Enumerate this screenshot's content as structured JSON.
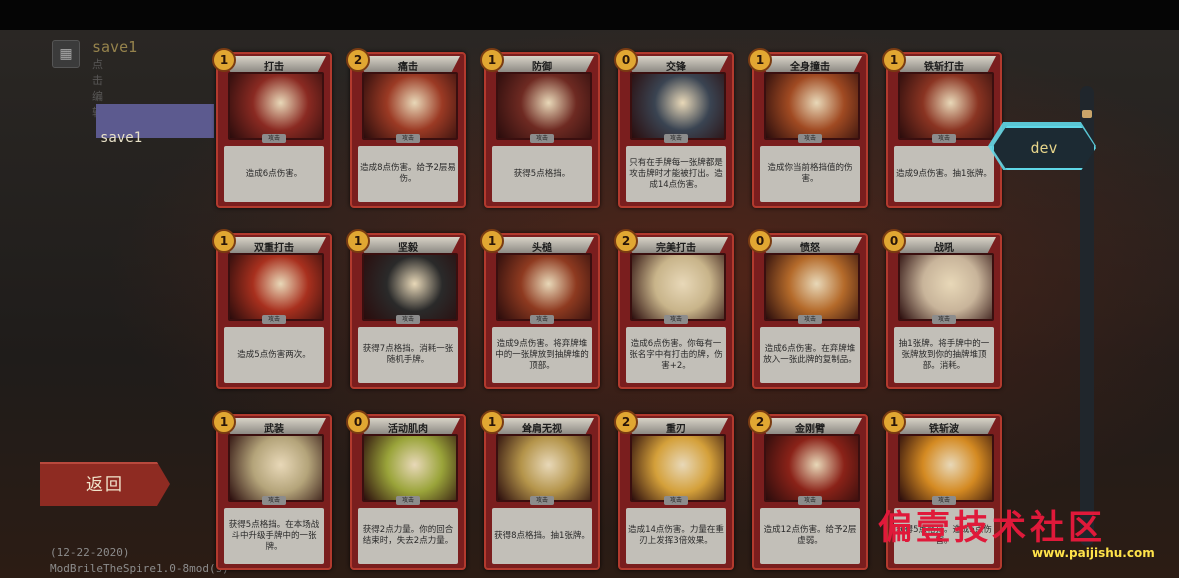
{
  "save": {
    "name": "save1",
    "subtitle": "点击编辑",
    "slot_label": "save1"
  },
  "back_label": "返回",
  "dev_label": "dev",
  "footer": {
    "date": "(12-22-2020)",
    "mod": "ModBrileTheSpire1.0-8mod(s)"
  },
  "watermark": {
    "text": "偏壹技术社区",
    "url": "www.paijishu.com"
  },
  "card_type_label": "攻击",
  "colors": {
    "card_frame": "#b23a2e",
    "card_body": "#7a1e1e",
    "cost_orb": "#e1a732",
    "dev_border": "#5fd8e8",
    "back_button": "#8e2b22"
  },
  "cards": [
    {
      "name": "打击",
      "cost": "1",
      "desc": "造成6点伤害。",
      "art": "#8a2a22"
    },
    {
      "name": "痛击",
      "cost": "2",
      "desc": "造成8点伤害。给予2层易伤。",
      "art": "#9b3a24"
    },
    {
      "name": "防御",
      "cost": "1",
      "desc": "获得5点格挡。",
      "art": "#6e2a22"
    },
    {
      "name": "交锋",
      "cost": "0",
      "desc": "只有在手牌每一张牌都是攻击牌时才能被打出。造成14点伤害。",
      "art": "#3a4452"
    },
    {
      "name": "全身撞击",
      "cost": "1",
      "desc": "造成你当前格挡值的伤害。",
      "art": "#a04a22"
    },
    {
      "name": "铁斩打击",
      "cost": "1",
      "desc": "造成9点伤害。抽1张牌。",
      "art": "#8a3422"
    },
    {
      "name": "双重打击",
      "cost": "1",
      "desc": "造成5点伤害两次。",
      "art": "#a8301e"
    },
    {
      "name": "坚毅",
      "cost": "1",
      "desc": "获得7点格挡。消耗一张随机手牌。",
      "art": "#2a2a2a"
    },
    {
      "name": "头槌",
      "cost": "1",
      "desc": "造成9点伤害。将弃牌堆中的一张牌放到抽牌堆的顶部。",
      "art": "#8e3a20"
    },
    {
      "name": "完美打击",
      "cost": "2",
      "desc": "造成6点伤害。你每有一张名字中有打击的牌，伤害+2。",
      "art": "#c8b48a"
    },
    {
      "name": "愤怒",
      "cost": "0",
      "desc": "造成6点伤害。在弃牌堆放入一张此牌的复制品。",
      "art": "#b46a2a"
    },
    {
      "name": "战吼",
      "cost": "0",
      "desc": "抽1张牌。将手牌中的一张牌放到你的抽牌堆顶部。消耗。",
      "art": "#c8b49a"
    },
    {
      "name": "武装",
      "cost": "1",
      "desc": "获得5点格挡。在本场战斗中升级手牌中的一张牌。",
      "art": "#b4a47a"
    },
    {
      "name": "活动肌肉",
      "cost": "0",
      "desc": "获得2点力量。你的回合结束时，失去2点力量。",
      "art": "#9aa43a"
    },
    {
      "name": "耸肩无视",
      "cost": "1",
      "desc": "获得8点格挡。抽1张牌。",
      "art": "#b4944a"
    },
    {
      "name": "重刃",
      "cost": "2",
      "desc": "造成14点伤害。力量在重刃上发挥3倍效果。",
      "art": "#d4a03a"
    },
    {
      "name": "金刚臂",
      "cost": "2",
      "desc": "造成12点伤害。给予2层虚弱。",
      "art": "#8a2218"
    },
    {
      "name": "铁斩波",
      "cost": "1",
      "desc": "获得5点格挡。造成5点伤害。",
      "art": "#d48a22"
    }
  ]
}
